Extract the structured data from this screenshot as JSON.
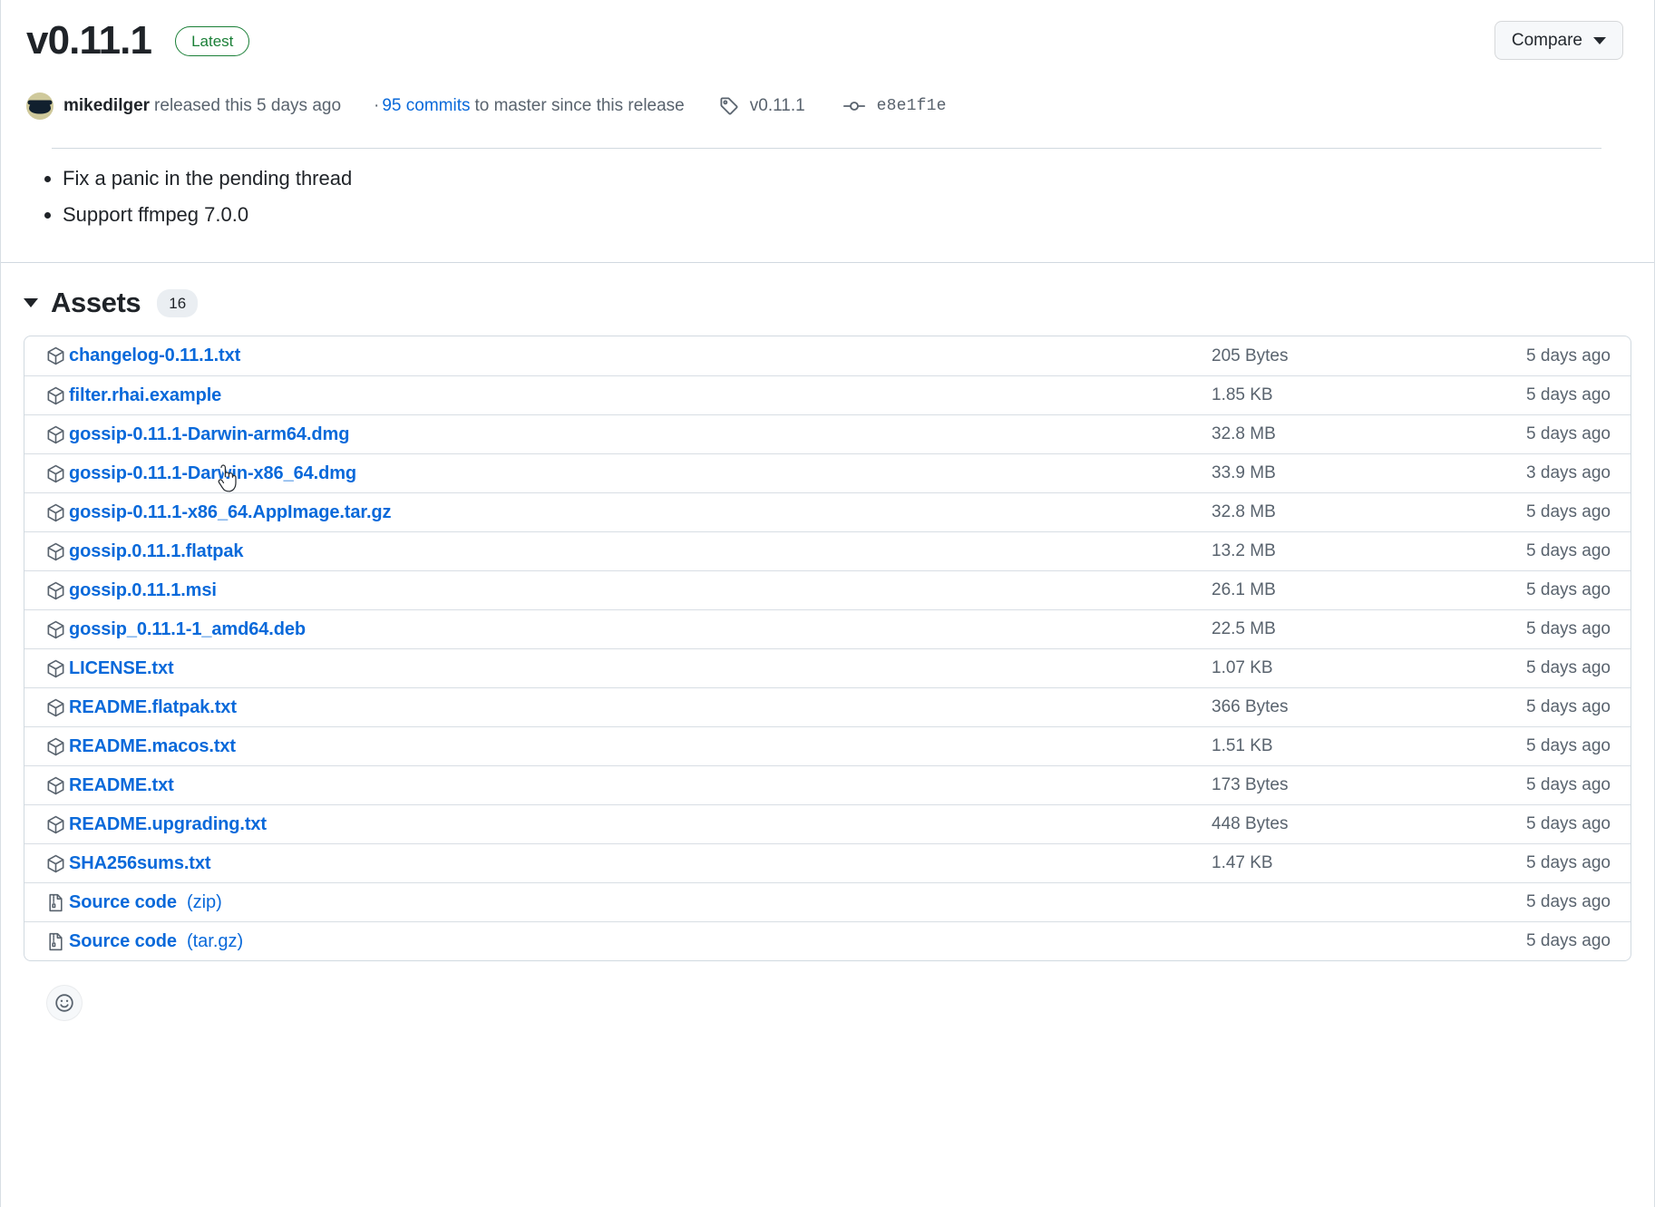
{
  "release": {
    "version": "v0.11.1",
    "latest_badge": "Latest",
    "compare_label": "Compare",
    "author": "mikedilger",
    "released_text": "released this 5 days ago",
    "separator": "·",
    "commits_link": "95 commits",
    "commits_tail": "to master since this release",
    "tag_name": "v0.11.1",
    "commit_sha": "e8e1f1e",
    "notes": [
      "Fix a panic in the pending thread",
      "Support ffmpeg 7.0.0"
    ]
  },
  "assets": {
    "title": "Assets",
    "count": "16",
    "rows": [
      {
        "icon": "package-icon",
        "name": "changelog-0.11.1.txt",
        "suffix": "",
        "size": "205 Bytes",
        "date": "5 days ago"
      },
      {
        "icon": "package-icon",
        "name": "filter.rhai.example",
        "suffix": "",
        "size": "1.85 KB",
        "date": "5 days ago"
      },
      {
        "icon": "package-icon",
        "name": "gossip-0.11.1-Darwin-arm64.dmg",
        "suffix": "",
        "size": "32.8 MB",
        "date": "5 days ago"
      },
      {
        "icon": "package-icon",
        "name": "gossip-0.11.1-Darwin-x86_64.dmg",
        "suffix": "",
        "size": "33.9 MB",
        "date": "3 days ago"
      },
      {
        "icon": "package-icon",
        "name": "gossip-0.11.1-x86_64.AppImage.tar.gz",
        "suffix": "",
        "size": "32.8 MB",
        "date": "5 days ago"
      },
      {
        "icon": "package-icon",
        "name": "gossip.0.11.1.flatpak",
        "suffix": "",
        "size": "13.2 MB",
        "date": "5 days ago"
      },
      {
        "icon": "package-icon",
        "name": "gossip.0.11.1.msi",
        "suffix": "",
        "size": "26.1 MB",
        "date": "5 days ago"
      },
      {
        "icon": "package-icon",
        "name": "gossip_0.11.1-1_amd64.deb",
        "suffix": "",
        "size": "22.5 MB",
        "date": "5 days ago"
      },
      {
        "icon": "package-icon",
        "name": "LICENSE.txt",
        "suffix": "",
        "size": "1.07 KB",
        "date": "5 days ago"
      },
      {
        "icon": "package-icon",
        "name": "README.flatpak.txt",
        "suffix": "",
        "size": "366 Bytes",
        "date": "5 days ago"
      },
      {
        "icon": "package-icon",
        "name": "README.macos.txt",
        "suffix": "",
        "size": "1.51 KB",
        "date": "5 days ago"
      },
      {
        "icon": "package-icon",
        "name": "README.txt",
        "suffix": "",
        "size": "173 Bytes",
        "date": "5 days ago"
      },
      {
        "icon": "package-icon",
        "name": "README.upgrading.txt",
        "suffix": "",
        "size": "448 Bytes",
        "date": "5 days ago"
      },
      {
        "icon": "package-icon",
        "name": "SHA256sums.txt",
        "suffix": "",
        "size": "1.47 KB",
        "date": "5 days ago"
      },
      {
        "icon": "file-zip-icon",
        "name": "Source code",
        "suffix": "(zip)",
        "size": "",
        "date": "5 days ago"
      },
      {
        "icon": "file-zip-icon",
        "name": "Source code",
        "suffix": "(tar.gz)",
        "size": "",
        "date": "5 days ago"
      }
    ]
  },
  "reactions": {
    "add_reaction_icon": "smiley-icon"
  },
  "colors": {
    "link": "#0969da",
    "latest_green": "#1a7f37",
    "muted": "#59636e",
    "border": "#d1d9e0"
  }
}
